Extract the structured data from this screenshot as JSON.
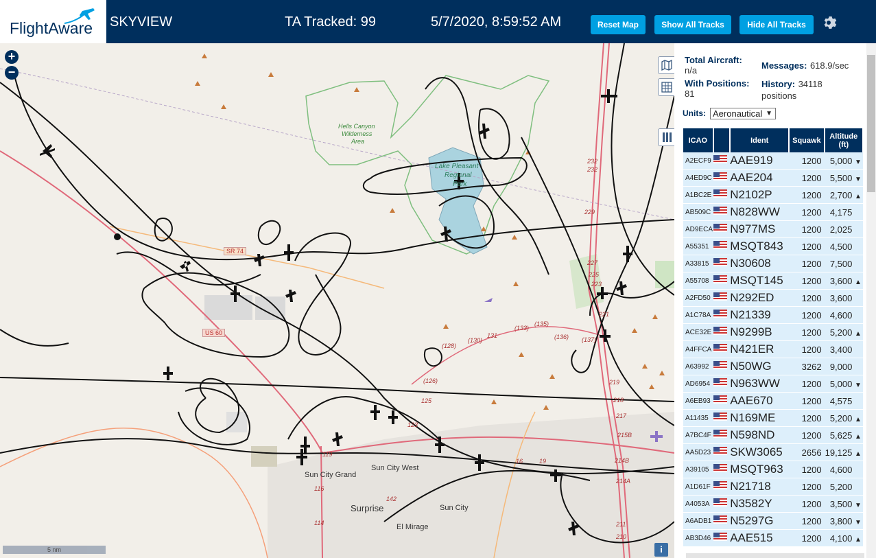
{
  "header": {
    "logo": "FlightAware",
    "app_name": "SKYVIEW",
    "tracked": "TA Tracked: 99",
    "datetime": "5/7/2020, 8:59:52 AM",
    "buttons": {
      "reset": "Reset Map",
      "show_all": "Show All Tracks",
      "hide_all": "Hide All Tracks"
    },
    "icons": {
      "settings": "gear-icon"
    }
  },
  "map": {
    "controls": {
      "zoom_in": "+",
      "zoom_out": "−",
      "layers_icon": "map-icon",
      "grid_icon": "grid-icon",
      "columns_icon": "columns-icon",
      "info": "i"
    },
    "scale": "5 nm",
    "labels": {
      "wilderness1": "Hells Canyon",
      "wilderness2": "Wilderness",
      "wilderness3": "Area",
      "lake1": "Lake Pleasant",
      "lake2": "Regional",
      "lake3": "Park",
      "us60": "US 60",
      "sr74": "SR 74",
      "sun_city_grand": "Sun City Grand",
      "sun_city_west": "Sun City West",
      "surprise": "Surprise",
      "sun_city": "Sun City",
      "el_mirage": "El Mirage",
      "r232a": "232",
      "r232b": "232",
      "r231": "231",
      "r229": "229",
      "r227": "227",
      "r225": "225",
      "r223": "223",
      "r221": "221",
      "r219": "219",
      "r218": "218",
      "r217": "217",
      "r215b": "215B",
      "r214b": "214B",
      "r214a": "214A",
      "r211": "211",
      "r210": "210",
      "r128": "(128)",
      "r126": "(126)",
      "r130": "(130)",
      "r131": "131",
      "r133": "(133)",
      "r135": "(135)",
      "r136": "(136)",
      "r137": "(137)",
      "r125": "125",
      "r123": "123",
      "r119": "119",
      "r116": "116",
      "r114": "114",
      "r142": "142",
      "r16": "16",
      "r19": "19"
    }
  },
  "stats": {
    "total_label": "Total Aircraft:",
    "total_value": "n/a",
    "positions_label": "With Positions:",
    "positions_value": "81",
    "messages_label": "Messages:",
    "messages_value": "618.9/sec",
    "history_label": "History:",
    "history_value": "34118",
    "history_unit": "positions",
    "units_label": "Units:",
    "units_value": "Aeronautical"
  },
  "table": {
    "headers": {
      "icao": "ICAO",
      "ident": "Ident",
      "squawk": "Squawk",
      "altitude": "Altitude",
      "altitude_unit": "(ft)"
    },
    "rows": [
      {
        "icao": "A2ECF9",
        "ident": "AAE919",
        "squawk": "1200",
        "alt": "5,000",
        "trend": "▼"
      },
      {
        "icao": "A4ED9C",
        "ident": "AAE204",
        "squawk": "1200",
        "alt": "5,500",
        "trend": "▼"
      },
      {
        "icao": "A1BC2E",
        "ident": "N2102P",
        "squawk": "1200",
        "alt": "2,700",
        "trend": "▲"
      },
      {
        "icao": "AB509C",
        "ident": "N828WW",
        "squawk": "1200",
        "alt": "4,175",
        "trend": ""
      },
      {
        "icao": "AD9ECA",
        "ident": "N977MS",
        "squawk": "1200",
        "alt": "2,025",
        "trend": ""
      },
      {
        "icao": "A55351",
        "ident": "MSQT843",
        "squawk": "1200",
        "alt": "4,500",
        "trend": ""
      },
      {
        "icao": "A33815",
        "ident": "N30608",
        "squawk": "1200",
        "alt": "7,500",
        "trend": ""
      },
      {
        "icao": "A55708",
        "ident": "MSQT145",
        "squawk": "1200",
        "alt": "3,600",
        "trend": "▲"
      },
      {
        "icao": "A2FD50",
        "ident": "N292ED",
        "squawk": "1200",
        "alt": "3,600",
        "trend": ""
      },
      {
        "icao": "A1C78A",
        "ident": "N21339",
        "squawk": "1200",
        "alt": "4,600",
        "trend": ""
      },
      {
        "icao": "ACE32E",
        "ident": "N9299B",
        "squawk": "1200",
        "alt": "5,200",
        "trend": "▲"
      },
      {
        "icao": "A4FFCA",
        "ident": "N421ER",
        "squawk": "1200",
        "alt": "3,400",
        "trend": ""
      },
      {
        "icao": "A63992",
        "ident": "N50WG",
        "squawk": "3262",
        "alt": "9,000",
        "trend": ""
      },
      {
        "icao": "AD6954",
        "ident": "N963WW",
        "squawk": "1200",
        "alt": "5,000",
        "trend": "▼"
      },
      {
        "icao": "A6EB93",
        "ident": "AAE670",
        "squawk": "1200",
        "alt": "4,575",
        "trend": ""
      },
      {
        "icao": "A11435",
        "ident": "N169ME",
        "squawk": "1200",
        "alt": "5,200",
        "trend": "▲"
      },
      {
        "icao": "A7BC4F",
        "ident": "N598ND",
        "squawk": "1200",
        "alt": "5,625",
        "trend": "▲"
      },
      {
        "icao": "AA5D23",
        "ident": "SKW3065",
        "squawk": "2656",
        "alt": "19,125",
        "trend": "▲"
      },
      {
        "icao": "A39105",
        "ident": "MSQT963",
        "squawk": "1200",
        "alt": "4,600",
        "trend": ""
      },
      {
        "icao": "A1D61F",
        "ident": "N21718",
        "squawk": "1200",
        "alt": "5,200",
        "trend": ""
      },
      {
        "icao": "A4053A",
        "ident": "N3582Y",
        "squawk": "1200",
        "alt": "3,500",
        "trend": "▼"
      },
      {
        "icao": "A6ADB1",
        "ident": "N5297G",
        "squawk": "1200",
        "alt": "3,800",
        "trend": "▼"
      },
      {
        "icao": "AB3D46",
        "ident": "AAE515",
        "squawk": "1200",
        "alt": "4,100",
        "trend": "▲"
      }
    ]
  },
  "colors": {
    "header_bg": "#002f5d",
    "button": "#00a0e2",
    "row_alt": "#ddeffb",
    "track": "#111111",
    "road": "#e0697a",
    "park_border": "#7fbf7f",
    "water": "#aad3df"
  }
}
